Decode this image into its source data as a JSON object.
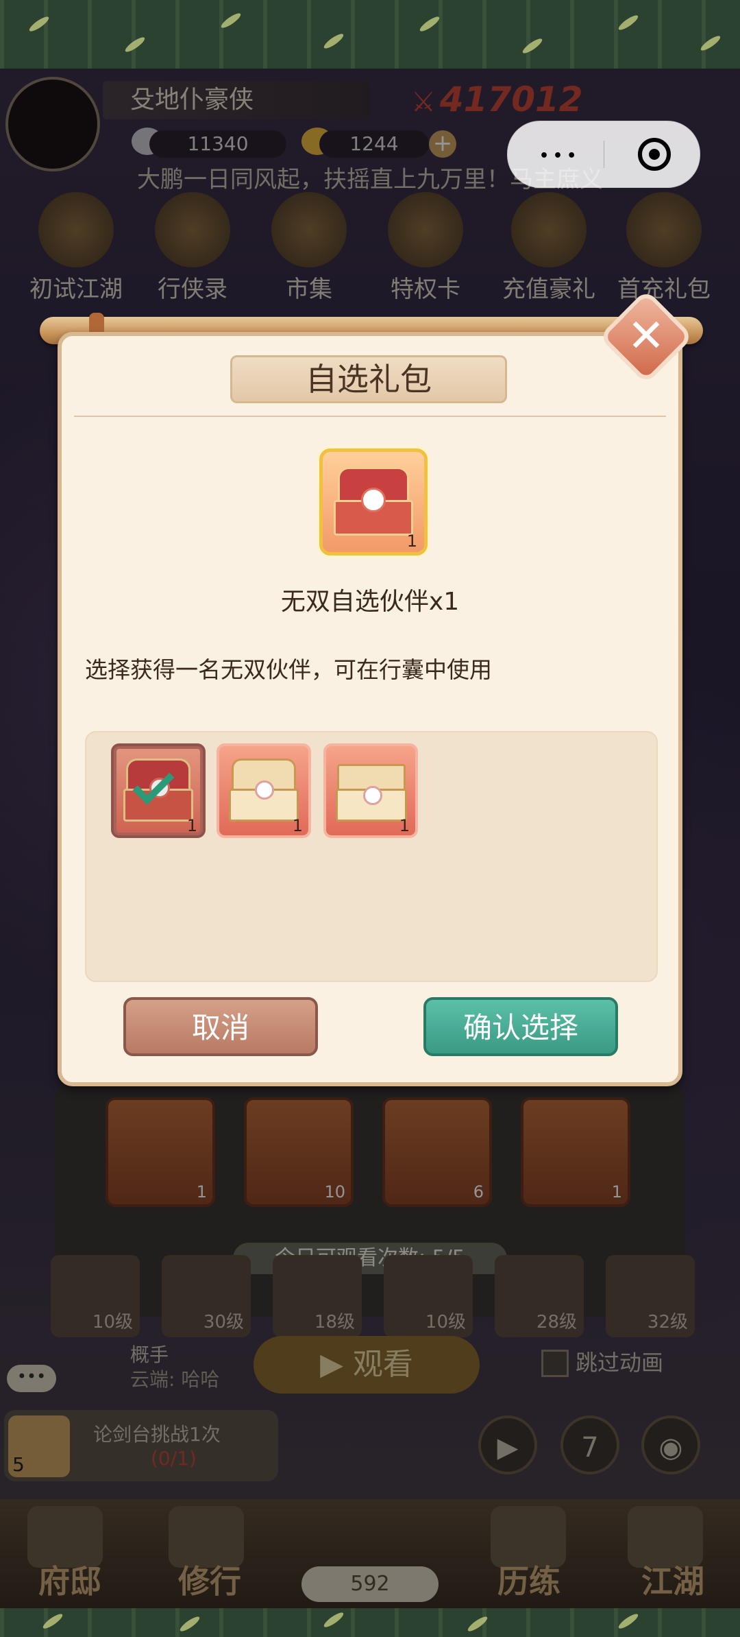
{
  "header": {
    "player_name": "殳地仆豪侠",
    "power": "417012",
    "silver": "11340",
    "gold": "1244",
    "marquee": "大鹏一日同风起，扶摇直上九万里！马主庶义"
  },
  "top_icons": [
    {
      "label": "初试江湖"
    },
    {
      "label": "行侠录"
    },
    {
      "label": "市集"
    },
    {
      "label": "特权卡"
    },
    {
      "label": "充值豪礼"
    },
    {
      "label": "首充礼包"
    }
  ],
  "background_panel": {
    "rewards": [
      {
        "count": "1"
      },
      {
        "count": "10"
      },
      {
        "count": "6"
      },
      {
        "count": "1"
      }
    ],
    "watch_count_text": "今日可观看次数: 5/5",
    "levels": [
      "10级",
      "30级",
      "18级",
      "10级",
      "28级",
      "32级"
    ],
    "watch_button": "观看",
    "skip_animation": "跳过动画",
    "chat_bubble": "•••",
    "chat_name": "概手",
    "chat_message": "云端: 哈哈",
    "task_count": "5",
    "task_text": "论剑台挑战1次",
    "task_progress": "(0/1)",
    "round_button_number": "7"
  },
  "bottom_nav": {
    "items": [
      {
        "label": "府邸"
      },
      {
        "label": "修行"
      },
      {
        "label": "历练"
      },
      {
        "label": "江湖"
      }
    ],
    "gold_count": "592"
  },
  "dialog": {
    "title": "自选礼包",
    "item_count": "1",
    "item_name": "无双自选伙伴x1",
    "description": "选择获得一名无双伙伴，可在行囊中使用",
    "choices": [
      {
        "count": "1",
        "selected": true
      },
      {
        "count": "1",
        "selected": false
      },
      {
        "count": "1",
        "selected": false
      }
    ],
    "cancel_label": "取消",
    "confirm_label": "确认选择"
  },
  "colors": {
    "confirm_button": "#3a9a84",
    "cancel_button": "#b87a64",
    "dialog_bg": "#fbf1e3",
    "check_mark": "#2a9a78"
  }
}
